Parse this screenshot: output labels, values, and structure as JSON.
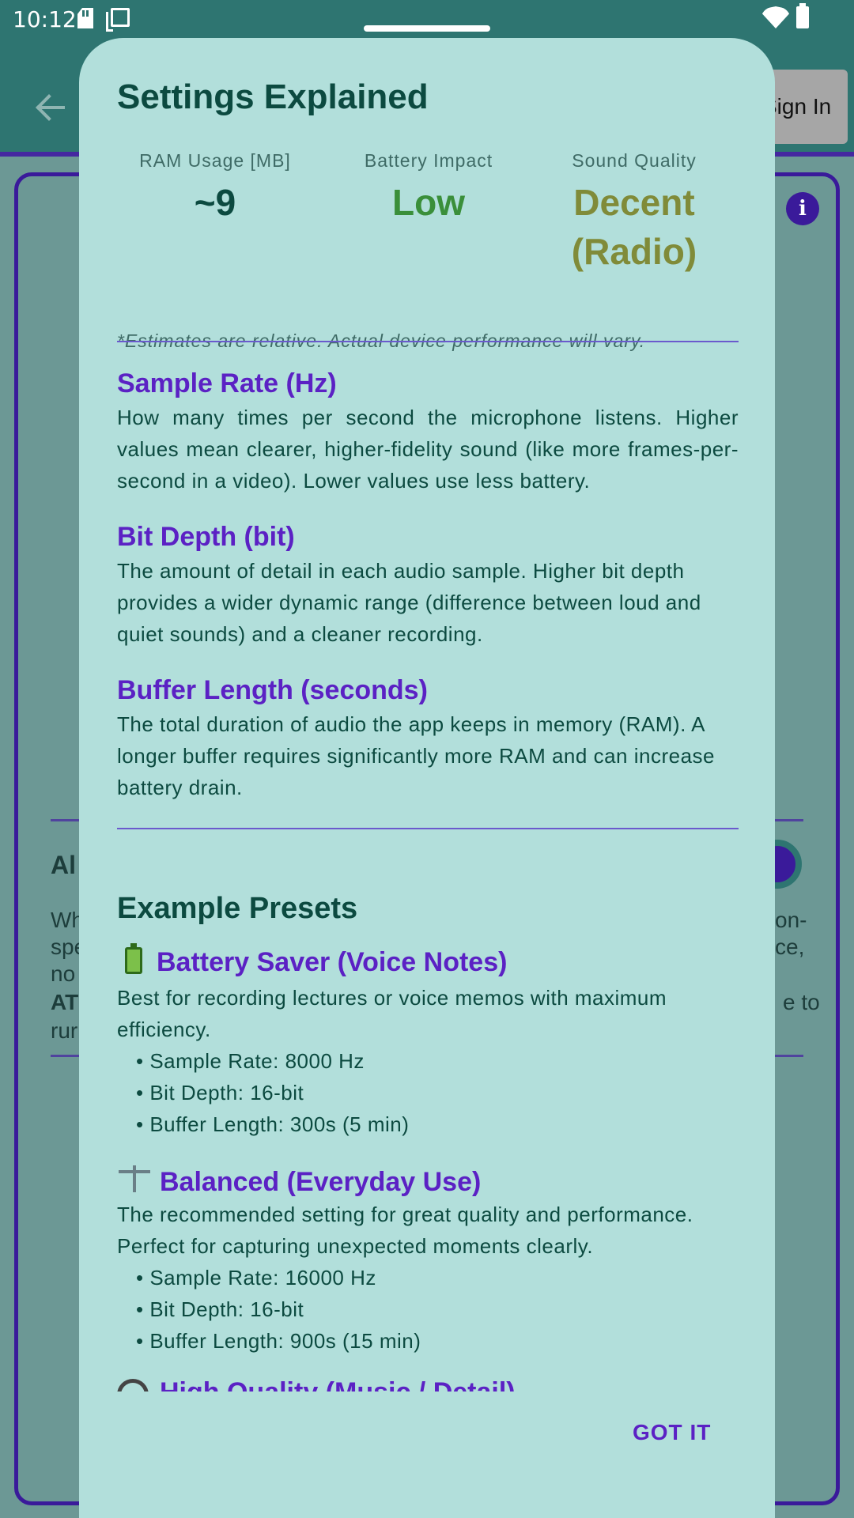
{
  "status_bar": {
    "time": "10:12"
  },
  "app_bar": {
    "sign_in_label": "Sign In"
  },
  "background": {
    "left_fragments": [
      "Al",
      "Wh",
      "spe",
      "no",
      "AT",
      "rur"
    ],
    "right_fragments": [
      "on-",
      "ce,",
      "e to"
    ]
  },
  "dialog": {
    "title": "Settings Explained",
    "stats": [
      {
        "label": "RAM Usage [MB]",
        "value": "~9",
        "color": "#0c4a40"
      },
      {
        "label": "Battery Impact",
        "value": "Low",
        "color": "#3a8f3a"
      },
      {
        "label": "Sound Quality",
        "value": "Decent (Radio)",
        "color": "#808b39"
      }
    ],
    "disclaimer": "*Estimates are relative. Actual device performance will vary.",
    "sections": [
      {
        "title": "Sample Rate (Hz)",
        "body": "How many times per second the microphone listens. Higher values mean clearer, higher-fidelity sound (like more frames-per-second in a video). Lower values use less battery."
      },
      {
        "title": "Bit Depth (bit)",
        "body": "The amount of detail in each audio sample. Higher bit depth provides a wider dynamic range (difference between loud and quiet sounds) and a cleaner recording."
      },
      {
        "title": "Buffer Length (seconds)",
        "body": "The total duration of audio the app keeps in memory (RAM). A longer buffer requires significantly more RAM and can increase battery drain."
      }
    ],
    "presets_title": "Example Presets",
    "presets": [
      {
        "icon": "battery-icon",
        "title": "Battery Saver (Voice Notes)",
        "description": "Best for recording lectures or voice memos with maximum efficiency.",
        "bullets": [
          "• Sample Rate: 8000 Hz",
          "• Bit Depth: 16-bit",
          "• Buffer Length: 300s (5 min)"
        ]
      },
      {
        "icon": "balance-scale-icon",
        "title": "Balanced (Everyday Use)",
        "description": "The recommended setting for great quality and performance. Perfect for capturing unexpected moments clearly.",
        "bullets": [
          "• Sample Rate: 16000 Hz",
          "• Bit Depth: 16-bit",
          "• Buffer Length: 900s (15 min)"
        ]
      },
      {
        "icon": "headphones-icon",
        "title": "High Quality (Music / Detail)"
      }
    ],
    "confirm_label": "GOT IT"
  },
  "colors": {
    "accent": "#5b21c4",
    "heading": "#0c4a40",
    "sheet_background": "#b2dfdb",
    "app_bar": "#2e7571"
  }
}
